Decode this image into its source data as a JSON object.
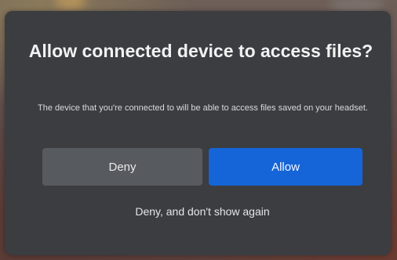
{
  "dialog": {
    "title": "Allow connected device to access files?",
    "body": "The device that you're connected to will be able to access files saved on your headset.",
    "deny_label": "Deny",
    "allow_label": "Allow",
    "deny_forever_label": "Deny, and don't show again"
  },
  "colors": {
    "dialog_background": "#3b3d41",
    "deny_button": "#575a5f",
    "allow_button": "#1565d8",
    "text": "#f2f2f2"
  }
}
